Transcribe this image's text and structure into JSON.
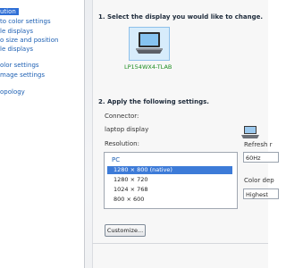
{
  "sidebar": {
    "items": [
      {
        "label": "ution",
        "active": true
      },
      {
        "label": "to color settings"
      },
      {
        "label": "le displays"
      },
      {
        "label": "o size and position"
      },
      {
        "label": "le displays"
      },
      {
        "label": "olor settings"
      },
      {
        "label": "mage settings"
      },
      {
        "label": "opology"
      }
    ]
  },
  "main": {
    "step1": "1. Select the display you would like to change.",
    "display_name": "LP154WX4-TLAB",
    "step2": "2. Apply the following settings.",
    "connector_label": "Connector:",
    "connector_value": "laptop display",
    "resolution_label": "Resolution:",
    "resolution_group": "PC",
    "resolutions": [
      "1280 × 800 (native)",
      "1280 × 720",
      "1024 × 768",
      "800 × 600"
    ],
    "refresh_label": "Refresh r",
    "refresh_value": "60Hz",
    "color_depth_label": "Color dep",
    "color_depth_value": "Highest",
    "customize_label": "Customize..."
  },
  "colors": {
    "accent": "#2f6fd6",
    "link": "#1c5fb3",
    "display_name": "#1e8e21"
  }
}
